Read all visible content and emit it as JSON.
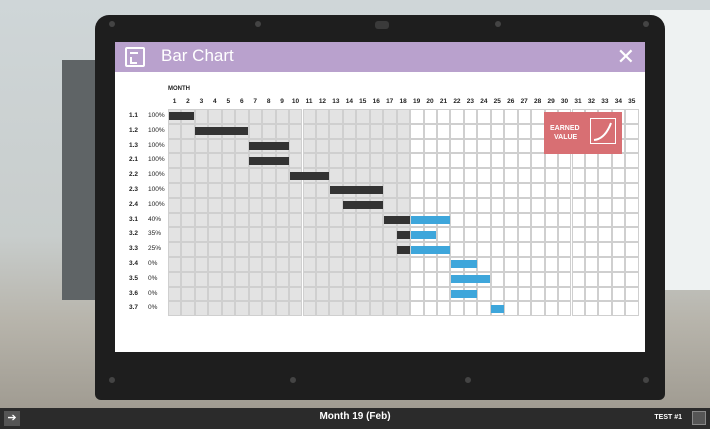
{
  "window": {
    "title": "Bar Chart",
    "close_glyph": "✕"
  },
  "chart": {
    "month_label": "MONTH",
    "months": [
      "1",
      "2",
      "3",
      "4",
      "5",
      "6",
      "7",
      "8",
      "9",
      "10",
      "11",
      "12",
      "13",
      "14",
      "15",
      "16",
      "17",
      "18",
      "19",
      "20",
      "21",
      "22",
      "23",
      "24",
      "25",
      "26",
      "27",
      "28",
      "29",
      "30",
      "31",
      "32",
      "33",
      "34",
      "35"
    ],
    "current_month": 19,
    "colors": {
      "completed": "#333333",
      "planned": "#3ea6db",
      "past_shade": "#e3e3e3"
    }
  },
  "chart_data": {
    "type": "gantt",
    "tasks": [
      {
        "id": "1.1",
        "percent": "100%",
        "completed": [
          1,
          2
        ],
        "planned": []
      },
      {
        "id": "1.2",
        "percent": "100%",
        "completed": [
          3,
          6
        ],
        "planned": []
      },
      {
        "id": "1.3",
        "percent": "100%",
        "completed": [
          7,
          9
        ],
        "planned": []
      },
      {
        "id": "2.1",
        "percent": "100%",
        "completed": [
          7,
          9
        ],
        "planned": []
      },
      {
        "id": "2.2",
        "percent": "100%",
        "completed": [
          10,
          12
        ],
        "planned": []
      },
      {
        "id": "2.3",
        "percent": "100%",
        "completed": [
          13,
          16
        ],
        "planned": []
      },
      {
        "id": "2.4",
        "percent": "100%",
        "completed": [
          14,
          16
        ],
        "planned": []
      },
      {
        "id": "3.1",
        "percent": "40%",
        "completed": [
          17,
          18
        ],
        "planned": [
          19,
          21
        ]
      },
      {
        "id": "3.2",
        "percent": "35%",
        "completed": [
          18,
          18
        ],
        "planned": [
          19,
          20
        ]
      },
      {
        "id": "3.3",
        "percent": "25%",
        "completed": [
          18,
          18
        ],
        "planned": [
          19,
          21
        ]
      },
      {
        "id": "3.4",
        "percent": "0%",
        "completed": [],
        "planned": [
          22,
          23
        ]
      },
      {
        "id": "3.5",
        "percent": "0%",
        "completed": [],
        "planned": [
          22,
          24
        ]
      },
      {
        "id": "3.6",
        "percent": "0%",
        "completed": [],
        "planned": [
          22,
          23
        ]
      },
      {
        "id": "3.7",
        "percent": "0%",
        "completed": [],
        "planned": [
          25,
          25
        ]
      }
    ]
  },
  "earned_value": {
    "line1": "EARNED",
    "line2": "VALUE"
  },
  "footer": {
    "status": "Month 19 (Feb)",
    "test": "TEST #1",
    "nav_glyph": "➔"
  }
}
